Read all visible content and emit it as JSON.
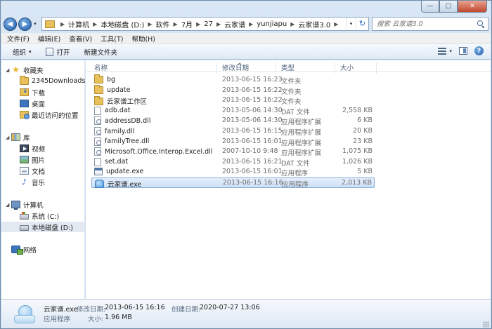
{
  "window": {
    "minimize_glyph": "—",
    "maximize_glyph": "□",
    "close_glyph": "✕"
  },
  "navigation": {
    "back_glyph": "◀",
    "forward_glyph": "▶",
    "history_glyph": "▾",
    "address_dropdown_glyph": "▾",
    "refresh_glyph": "↻",
    "breadcrumb": [
      "计算机",
      "本地磁盘 (D:)",
      "软件",
      "7月",
      "27",
      "云家谱",
      "yunjiapu",
      "云家谱3.0"
    ],
    "search_placeholder": "搜索 云家谱3.0"
  },
  "menubar": {
    "items": [
      "文件(F)",
      "编辑(E)",
      "查看(V)",
      "工具(T)",
      "帮助(H)"
    ]
  },
  "toolbar": {
    "organize": "组织",
    "organize_arrow": "▾",
    "open": "打开",
    "new_folder": "新建文件夹",
    "view_arrow": "▾",
    "help_glyph": "?"
  },
  "sidebar": {
    "favorites": {
      "label": "收藏夹",
      "items": [
        "2345Downloads",
        "下载",
        "桌面",
        "最近访问的位置"
      ]
    },
    "libraries": {
      "label": "库",
      "items": [
        "视频",
        "图片",
        "文档",
        "音乐"
      ]
    },
    "computer": {
      "label": "计算机",
      "items": [
        "系统 (C:)",
        "本地磁盘 (D:)"
      ]
    },
    "network": {
      "label": "网络"
    },
    "expand_glyph": "◢"
  },
  "file_list": {
    "columns": {
      "name": "名称",
      "date": "修改日期",
      "type": "类型",
      "size": "大小"
    },
    "sort_glyph": "^",
    "rows": [
      {
        "name": "bg",
        "date": "2013-06-15 16:23",
        "type": "文件夹",
        "size": "",
        "icon": "folder"
      },
      {
        "name": "update",
        "date": "2013-06-15 16:22",
        "type": "文件夹",
        "size": "",
        "icon": "folder"
      },
      {
        "name": "云家谱工作区",
        "date": "2013-06-15 16:22",
        "type": "文件夹",
        "size": "",
        "icon": "folder"
      },
      {
        "name": "adb.dat",
        "date": "2013-05-06 14:30",
        "type": "DAT 文件",
        "size": "2,558 KB",
        "icon": "file"
      },
      {
        "name": "addressDB.dll",
        "date": "2013-05-06 14:30",
        "type": "应用程序扩展",
        "size": "6 KB",
        "icon": "dll"
      },
      {
        "name": "family.dll",
        "date": "2013-06-15 16:15",
        "type": "应用程序扩展",
        "size": "20 KB",
        "icon": "dll"
      },
      {
        "name": "familyTree.dll",
        "date": "2013-06-15 16:01",
        "type": "应用程序扩展",
        "size": "23 KB",
        "icon": "dll"
      },
      {
        "name": "Microsoft.Office.Interop.Excel.dll",
        "date": "2007-10-10 9:48",
        "type": "应用程序扩展",
        "size": "1,075 KB",
        "icon": "dll"
      },
      {
        "name": "set.dat",
        "date": "2013-06-15 16:21",
        "type": "DAT 文件",
        "size": "1,026 KB",
        "icon": "file"
      },
      {
        "name": "update.exe",
        "date": "2013-06-15 16:01",
        "type": "应用程序",
        "size": "5 KB",
        "icon": "exe"
      },
      {
        "name": "云家谱.exe",
        "date": "2013-06-15 16:16",
        "type": "应用程序",
        "size": "2,013 KB",
        "icon": "app",
        "selected": true
      }
    ]
  },
  "details": {
    "name": "云家谱.exe",
    "modified_label": "修改日期:",
    "modified_value": "2013-06-15 16:16",
    "created_label": "创建日期:",
    "created_value": "2020-07-27 13:06",
    "type_value": "应用程序",
    "size_label": "大小:",
    "size_value": "1.96 MB"
  }
}
